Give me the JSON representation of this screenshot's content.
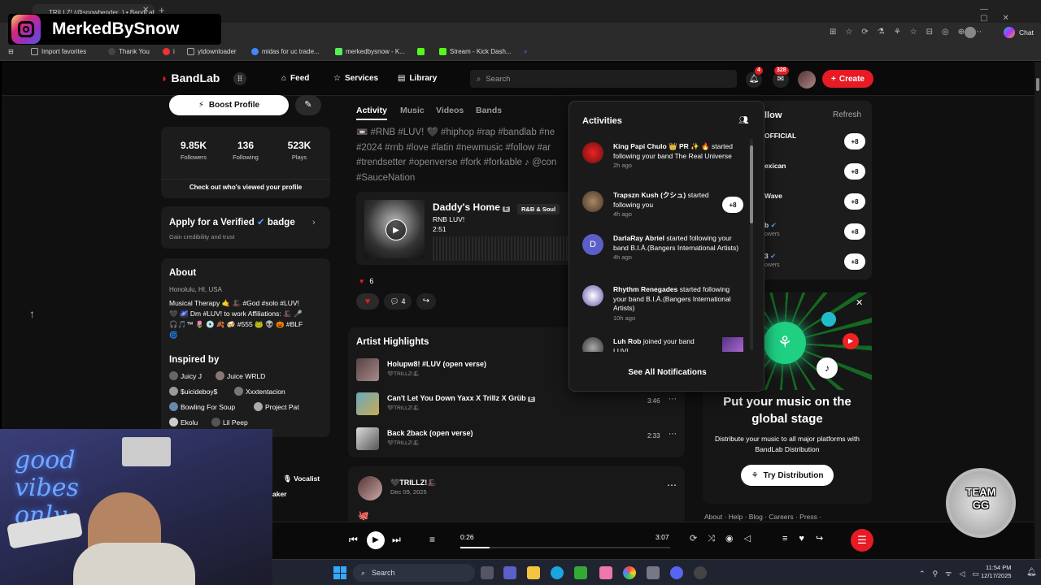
{
  "browser": {
    "tab_title": "TRILLZ! (@snowbender_) • BandLab",
    "chat_label": "Chat"
  },
  "favorites": {
    "items": [
      "Import favorites",
      "Thank You",
      "i",
      "ytdownloader",
      "midas for uc trade...",
      "merkedbysnow - K...",
      "Stream - Kick Dash..."
    ]
  },
  "overlay": {
    "channel_name": "MerkedBySnow",
    "team_badge": "TEAM GG"
  },
  "nav": {
    "logo": "BandLab",
    "feed": "Feed",
    "services": "Services",
    "library": "Library",
    "search_placeholder": "Search",
    "notif_count": "4",
    "msg_count": "328",
    "create": "Create"
  },
  "profile": {
    "boost": "Boost Profile",
    "followers_val": "9.85K",
    "followers_lbl": "Followers",
    "following_val": "136",
    "following_lbl": "Following",
    "plays_val": "523K",
    "plays_lbl": "Plays",
    "views": "Check out who's viewed your profile",
    "verified_title": "Apply for a Verified",
    "verified_badge": "badge",
    "verified_sub": "Gain credibility and trust",
    "about_title": "About",
    "location": "Honolulu, HI, USA",
    "bio1": "Musical Therapy 🤙 🎩 #God #solo #LUV!",
    "bio2": "🖤 🌌 Dm #LUV! to work Affiliations: 🎩 🎤",
    "bio3": "🎧🎵™ 🌷 💿 🍂 🍻 #555 🐸 👽 🎃 #BLF",
    "bio4": "🌀",
    "inspired_title": "Inspired by",
    "inspired": [
      "Juicy J",
      "Juice WRLD",
      "$uicideboy$",
      "Xxxtentacion",
      "Bowling For Soup",
      "Project Pat",
      "Ekolu",
      "Lil Peep"
    ],
    "skill": "Vocalist",
    "skill2": "aker"
  },
  "feed": {
    "tab_activity": "Activity",
    "tab_music": "Music",
    "tab_videos": "Videos",
    "tab_bands": "Bands",
    "hashtags1": "📼 #RNB #LUV! 🖤 #hiphop #rap #bandlab #ne",
    "hashtags2": "#2024 #rnb #love #latin #newmusic #follow #ar",
    "hashtags3": "#trendsetter #openverse #fork #forkable ♪ @con",
    "hashtags4": "#SauceNation",
    "track_title": "Daddy's Home",
    "track_genre": "R&B & Soul",
    "track_artist": "RNB LUV!",
    "track_time": "2:51",
    "likes": "6",
    "comments": "4",
    "highlights_title": "Artist Highlights",
    "highlights": [
      {
        "title": "Holupw8! #LUV (open verse)",
        "artist": "🖤TRILLZ!🎩",
        "time": ""
      },
      {
        "title": "Can't Let You Down Yaxx X Trillz X Grüb",
        "artist": "🖤TRILLZ!🎩",
        "time": "3:46"
      },
      {
        "title": "Back 2back (open verse)",
        "artist": "🖤TRILLZ!🎩",
        "time": "2:33"
      }
    ],
    "post_user": "🖤TRILLZ!🎩",
    "post_date": "Dec 09, 2025"
  },
  "activities": {
    "title": "Activities",
    "items": [
      {
        "name": "King Papi Chulo 👑 PR ✨ 🔥",
        "text": "started following your band The Real Universe",
        "when": "2h ago"
      },
      {
        "name": "Trapszn Kush (クシュ)",
        "text": "started following you",
        "when": "4h ago"
      },
      {
        "name": "DarlaRay Abriel",
        "text": "started following your band B.I.Ā.(Bangers International Artists)",
        "when": "4h ago"
      },
      {
        "name": "Rhythm Renegades",
        "text": "started following your band B.I.Ā.(Bangers International Artists)",
        "when": "10h ago"
      },
      {
        "name": "Luh Rob",
        "text": "joined your band LUV!",
        "when": ""
      }
    ],
    "see_all": "See All Notifications",
    "avatar_letter": "D"
  },
  "suggestions": {
    "title": "llow",
    "refresh": "Refresh",
    "items": [
      {
        "name": "OFFICIAL",
        "sub": ""
      },
      {
        "name": "exican",
        "sub": ""
      },
      {
        "name": "Wave",
        "sub": ""
      },
      {
        "name": "b",
        "sub": "owers"
      },
      {
        "name": "3",
        "sub": "owers"
      }
    ],
    "follow_icon": "+8"
  },
  "promo": {
    "title": "Put your music on the global stage",
    "sub": "Distribute your music to all major platforms with BandLab Distribution",
    "button": "Try Distribution"
  },
  "footer": {
    "links": "About · Help · Blog · Careers · Press ·"
  },
  "player": {
    "current": "0:26",
    "total": "3:07",
    "progress": 0.14
  },
  "taskbar": {
    "search": "Search",
    "time": "11:54 PM",
    "date": "12/17/2025"
  },
  "webcam": {
    "neon": "good vibes only"
  },
  "colors": {
    "brand": "#e61b23",
    "accent_link": "#4ea1ff",
    "tag_gray": "#8a8a8a"
  }
}
